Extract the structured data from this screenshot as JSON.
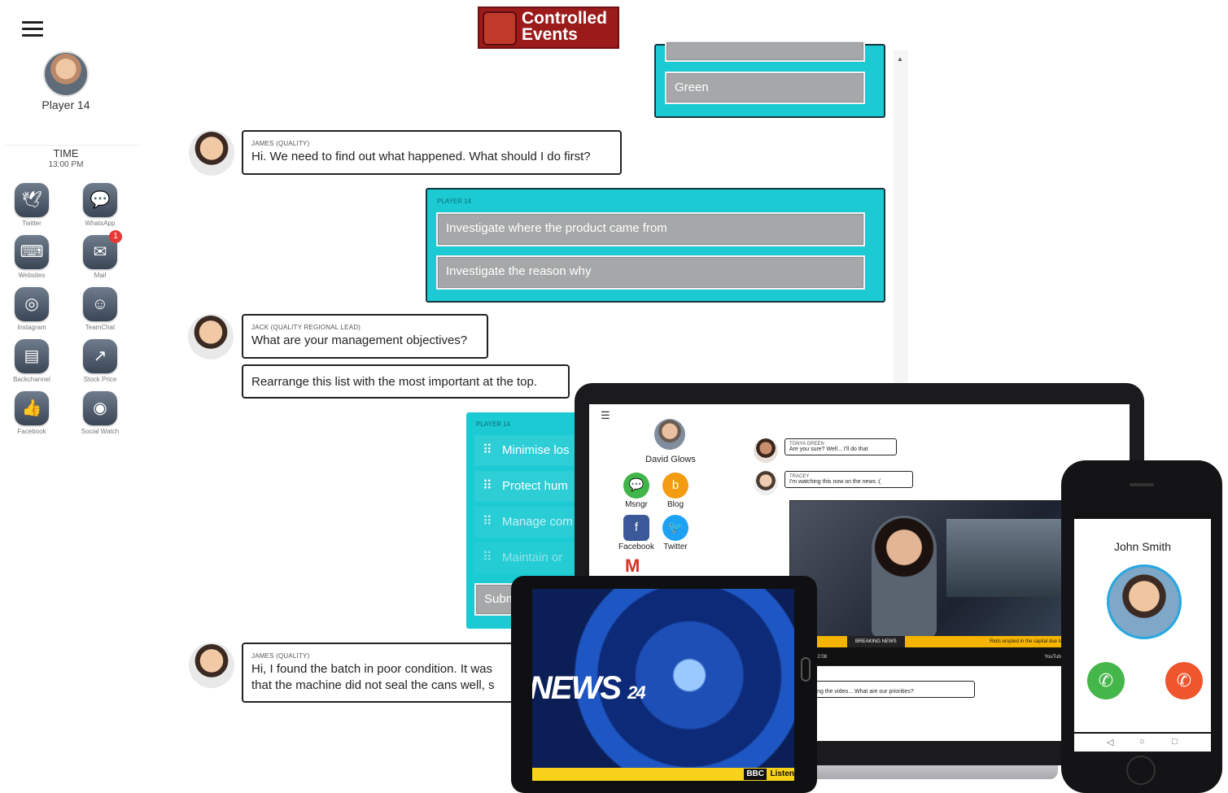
{
  "brand": {
    "line1": "Controlled",
    "line2": "Events"
  },
  "sidebar": {
    "player_name": "Player 14",
    "time_label": "TIME",
    "time_value": "13:00 PM",
    "apps": [
      {
        "label": "Twitter",
        "icon": "twitter-icon",
        "glyph": "🕊",
        "badge": ""
      },
      {
        "label": "WhatsApp",
        "icon": "whatsapp-icon",
        "glyph": "💬",
        "badge": ""
      },
      {
        "label": "Websites",
        "icon": "websites-icon",
        "glyph": "⌨",
        "badge": ""
      },
      {
        "label": "Mail",
        "icon": "mail-icon",
        "glyph": "✉",
        "badge": "1"
      },
      {
        "label": "Instagram",
        "icon": "instagram-icon",
        "glyph": "◎",
        "badge": ""
      },
      {
        "label": "TeamChat",
        "icon": "teamchat-icon",
        "glyph": "☺",
        "badge": ""
      },
      {
        "label": "Backchannel",
        "icon": "backchannel-icon",
        "glyph": "▤",
        "badge": ""
      },
      {
        "label": "Stock Price",
        "icon": "stock-price-icon",
        "glyph": "↗",
        "badge": ""
      },
      {
        "label": "Facebook",
        "icon": "facebook-like-icon",
        "glyph": "👍",
        "badge": ""
      },
      {
        "label": "Social Watch",
        "icon": "social-watch-icon",
        "glyph": "◉",
        "badge": ""
      }
    ]
  },
  "chat": {
    "top_option": "Green",
    "msg1": {
      "who": "JAMES (QUALITY)",
      "text": "Hi. We need to find out what happened. What should I do first?"
    },
    "reply1": {
      "who": "PLAYER 14",
      "options": [
        "Investigate where the product came from",
        "Investigate the reason why"
      ]
    },
    "msg2": {
      "who": "JACK (QUALITY REGIONAL LEAD)",
      "text": "What are your management objectives?"
    },
    "msg3": {
      "text": "Rearrange this list with the most important at the top."
    },
    "rank": {
      "who": "PLAYER 14",
      "items": [
        "Minimise los",
        "Protect hum",
        "Manage com",
        "Maintain or"
      ],
      "submit": "Subm"
    },
    "msg4": {
      "who": "JAMES (QUALITY)",
      "line1": "Hi, I found the batch in poor condition. It was",
      "line2": "that the machine did not seal the cans well, s"
    }
  },
  "laptop": {
    "user_name": "David Glows",
    "apps": [
      {
        "label": "Msngr",
        "icon": "messenger-icon",
        "glyph": "💬",
        "color": "#3fb54a"
      },
      {
        "label": "Blog",
        "icon": "blog-icon",
        "glyph": "b",
        "color": "#f39c12"
      },
      {
        "label": "Facebook",
        "icon": "facebook-icon",
        "glyph": "f",
        "color": "#3b5998"
      },
      {
        "label": "Twitter",
        "icon": "twitter-bird-icon",
        "glyph": "🐦",
        "color": "#1da1f2"
      }
    ],
    "bubble1": {
      "who": "TONYA GREEN",
      "text": "Are you sure? Well... I'll do that"
    },
    "bubble2": {
      "who": "TRACEY",
      "text": "I'm watching this now on the news :("
    },
    "video": {
      "banner": "BREAKING NEWS",
      "ticker": "Riots erupted in the capital due to t",
      "time": "0:11 / 2:08",
      "brand": "YouTube"
    },
    "bubble3": {
      "who": "ITH",
      "text": "r watching the video... What are our priorities?"
    }
  },
  "tablet": {
    "headline": "NEWS",
    "number": "24",
    "channel": "BBC",
    "ticker": "Listen"
  },
  "phone": {
    "caller": "John Smith"
  }
}
